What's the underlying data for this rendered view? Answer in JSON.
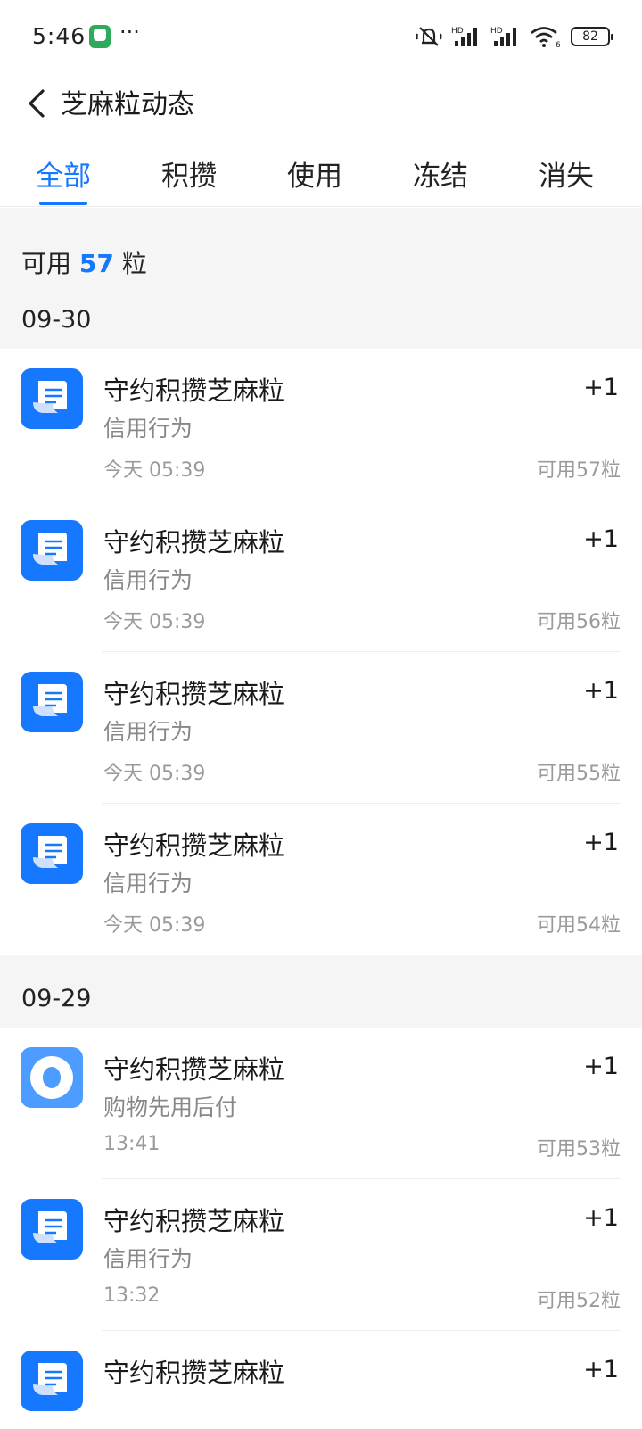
{
  "status_bar": {
    "time": "5:46",
    "dots": "···",
    "battery": "82",
    "icons": [
      "app-notification-icon",
      "mute-icon",
      "hd-signal-icon",
      "hd-signal-icon",
      "wifi-icon",
      "battery-icon"
    ]
  },
  "header": {
    "title": "芝麻粒动态",
    "back_icon": "chevron-left-icon"
  },
  "tabs": [
    {
      "label": "全部",
      "active": true
    },
    {
      "label": "积攒",
      "active": false
    },
    {
      "label": "使用",
      "active": false
    },
    {
      "label": "冻结",
      "active": false
    },
    {
      "label": "消失",
      "active": false
    }
  ],
  "summary": {
    "prefix": "可用",
    "count": "57",
    "unit": "粒"
  },
  "sections": [
    {
      "date": "09-30",
      "items": [
        {
          "icon": "receipt-icon",
          "title": "守约积攒芝麻粒",
          "sub": "信用行为",
          "time": "今天 05:39",
          "delta": "+1",
          "balance": "可用57粒"
        },
        {
          "icon": "receipt-icon",
          "title": "守约积攒芝麻粒",
          "sub": "信用行为",
          "time": "今天 05:39",
          "delta": "+1",
          "balance": "可用56粒"
        },
        {
          "icon": "receipt-icon",
          "title": "守约积攒芝麻粒",
          "sub": "信用行为",
          "time": "今天 05:39",
          "delta": "+1",
          "balance": "可用55粒"
        },
        {
          "icon": "receipt-icon",
          "title": "守约积攒芝麻粒",
          "sub": "信用行为",
          "time": "今天 05:39",
          "delta": "+1",
          "balance": "可用54粒"
        }
      ]
    },
    {
      "date": "09-29",
      "items": [
        {
          "icon": "ring-icon",
          "title": "守约积攒芝麻粒",
          "sub": "购物先用后付",
          "time": "13:41",
          "delta": "+1",
          "balance": "可用53粒"
        },
        {
          "icon": "receipt-icon",
          "title": "守约积攒芝麻粒",
          "sub": "信用行为",
          "time": "13:32",
          "delta": "+1",
          "balance": "可用52粒"
        },
        {
          "icon": "receipt-icon",
          "title": "守约积攒芝麻粒",
          "sub": "",
          "time": "",
          "delta": "+1",
          "balance": ""
        }
      ]
    }
  ],
  "colors": {
    "accent": "#1677ff",
    "background_gray": "#f5f5f5",
    "secondary_text": "#888888"
  }
}
